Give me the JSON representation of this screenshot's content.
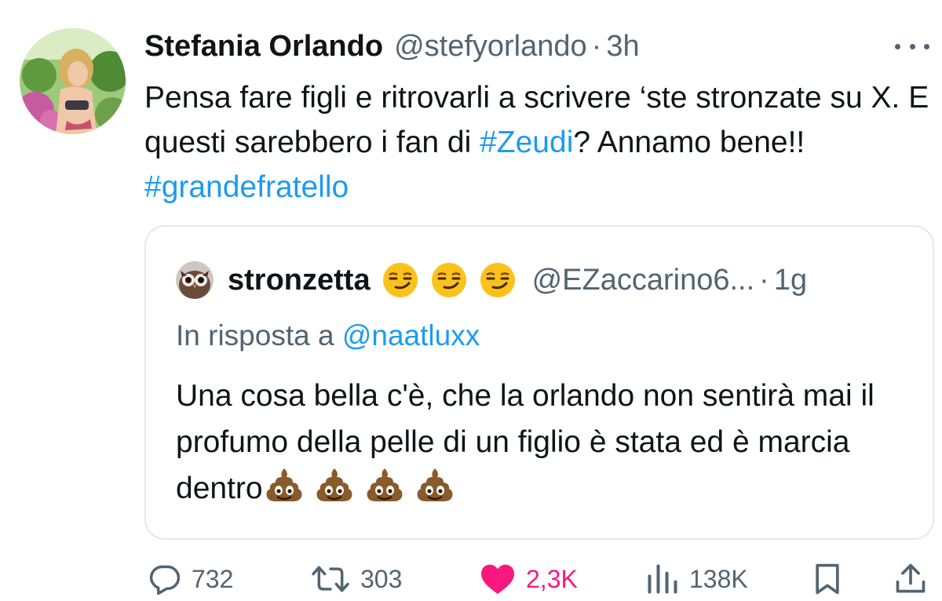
{
  "tweet": {
    "author": {
      "display_name": "Stefania Orlando",
      "handle": "@stefyorlando",
      "separator": "·",
      "time": "3h"
    },
    "text": {
      "line_pre": "Pensa fare figli e ritrovarli a scrivere ‘ste stronzate su X. E questi sarebbero i fan di ",
      "hashtag_1": "#Zeudi",
      "line_mid": "? Annamo bene!! ",
      "hashtag_2": "#grandefratello"
    }
  },
  "quote": {
    "author": {
      "display_name": "stronzetta",
      "emojis": [
        "smirking-face",
        "smirking-face",
        "smirking-face"
      ],
      "handle": "@EZaccarino6...",
      "separator": "·",
      "time": "1g"
    },
    "reply_prefix": "In risposta a ",
    "reply_mention": "@naatluxx",
    "text": "Una cosa bella c'è, che la orlando non sentirà mai il profumo della pelle di un figlio è stata ed è marcia dentro",
    "trailing_emojis": [
      "pile-of-poo",
      "pile-of-poo",
      "pile-of-poo",
      "pile-of-poo"
    ]
  },
  "actions": {
    "replies": "732",
    "reposts": "303",
    "likes": "2,3K",
    "views": "138K"
  },
  "colors": {
    "link": "#1d9bf0",
    "secondary_text": "#536471",
    "like": "#f91880",
    "border": "#e4e8eb"
  },
  "icons": [
    "more-icon",
    "reply-icon",
    "repost-icon",
    "like-icon",
    "views-icon",
    "bookmark-icon",
    "share-icon"
  ]
}
